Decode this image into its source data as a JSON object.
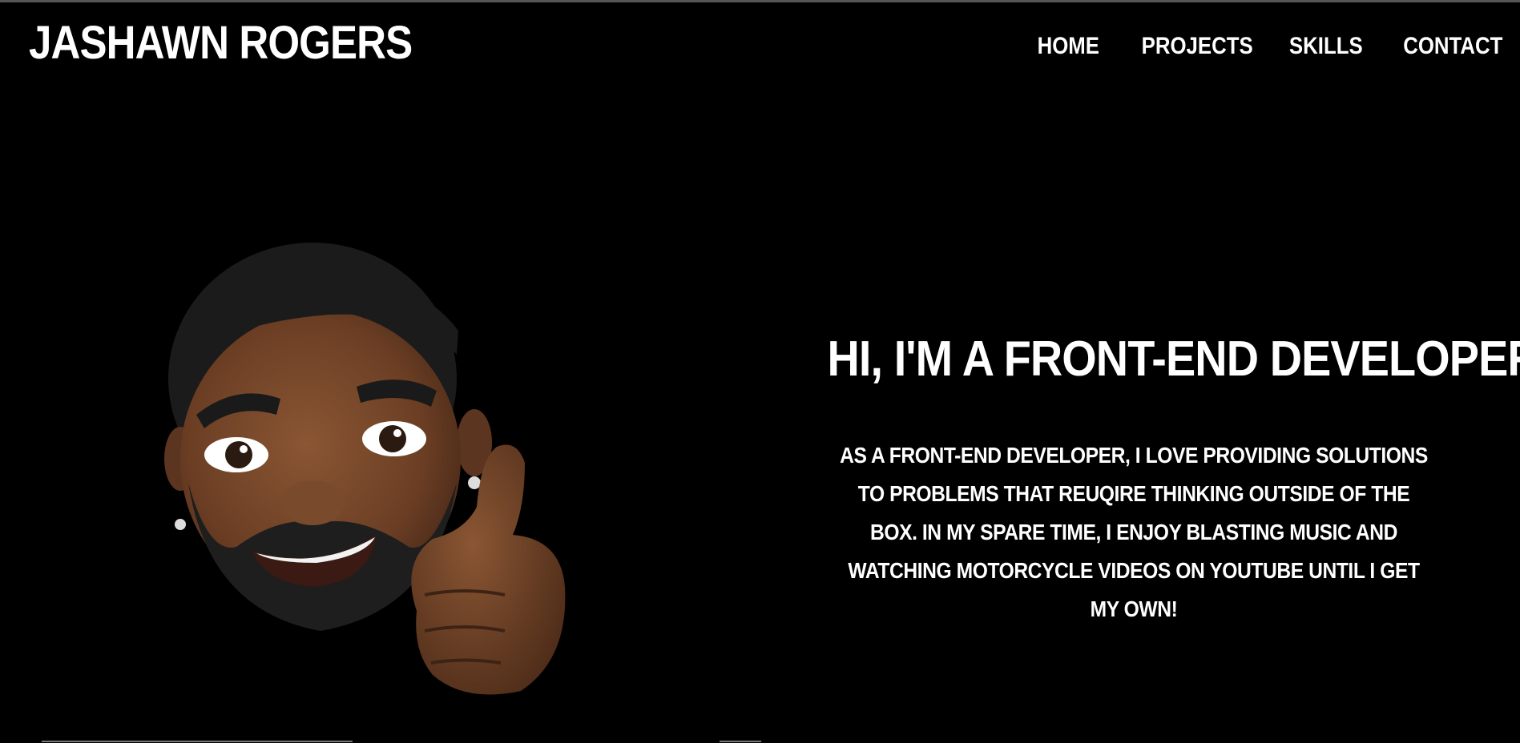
{
  "header": {
    "logo": "JASHAWN ROGERS",
    "nav": [
      {
        "label": "HOME"
      },
      {
        "label": "PROJECTS"
      },
      {
        "label": "SKILLS"
      },
      {
        "label": "CONTACT"
      }
    ]
  },
  "hero": {
    "title": "HI, I'M A FRONT-END DEVELOPER",
    "cursor": "|",
    "description": "AS A FRONT-END DEVELOPER, I LOVE PROVIDING SOLUTIONS TO PROBLEMS THAT REUQIRE THINKING OUTSIDE OF THE BOX. IN MY SPARE TIME, I ENJOY BLASTING MUSIC AND WATCHING MOTORCYCLE VIDEOS ON YOUTUBE UNTIL I GET MY OWN!"
  },
  "avatar": {
    "icon": "memoji-thumbs-up",
    "skin_color": "#6b3e24",
    "hair_color": "#1a1a1a"
  },
  "colors": {
    "background": "#000000",
    "text": "#ffffff"
  }
}
